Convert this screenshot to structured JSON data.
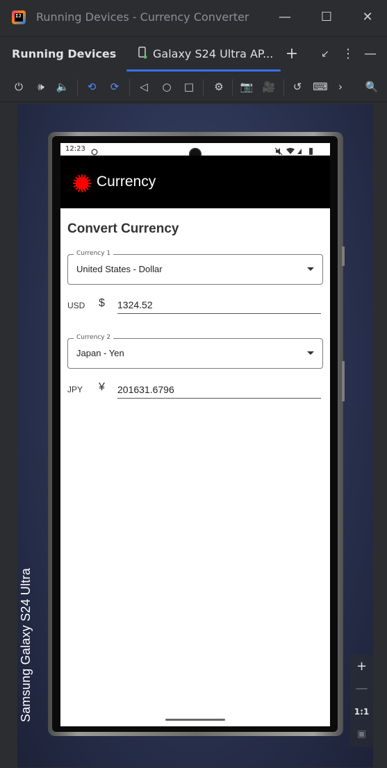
{
  "window": {
    "title": "Running Devices - Currency Converter",
    "logo_text": "IJ"
  },
  "tool_window": {
    "title": "Running Devices",
    "device_tab": "Galaxy S24 Ultra AP..."
  },
  "device": {
    "label": "Samsung Galaxy S24 Ultra",
    "status_time": "12:23"
  },
  "app": {
    "title": "Currency",
    "heading": "Convert Currency",
    "currency1": {
      "label": "Currency 1",
      "value": "United States - Dollar",
      "code": "USD",
      "symbol": "$",
      "amount": "1324.52"
    },
    "currency2": {
      "label": "Currency 2",
      "value": "Japan - Yen",
      "code": "JPY",
      "symbol": "¥",
      "amount": "201631.6796"
    }
  },
  "zoom": {
    "one_to_one": "1:1"
  },
  "colors": {
    "accent": "#3574f0",
    "app_bar": "#000000",
    "app_icon": "#ff0000"
  }
}
